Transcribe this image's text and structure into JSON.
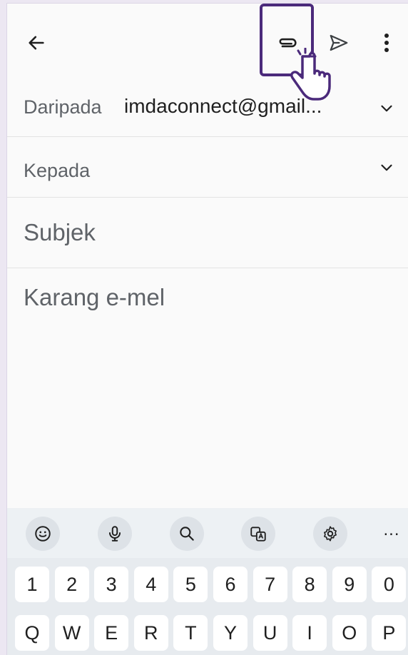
{
  "toolbar": {
    "back_icon": "arrow-left-icon",
    "attach_icon": "paperclip-icon",
    "send_icon": "send-icon",
    "more_icon": "more-vertical-icon"
  },
  "compose": {
    "from_label": "Daripada",
    "from_value": "imdaconnect@gmail...",
    "to_label": "Kepada",
    "subject_placeholder": "Subjek",
    "body_placeholder": "Karang e-mel"
  },
  "keyboard": {
    "tools": [
      "emoji-icon",
      "microphone-icon",
      "search-icon",
      "translate-icon",
      "settings-icon",
      "more-horizontal-icon"
    ],
    "more_label": "...",
    "number_row": [
      "1",
      "2",
      "3",
      "4",
      "5",
      "6",
      "7",
      "8",
      "9",
      "0"
    ],
    "letter_row": [
      "Q",
      "W",
      "E",
      "R",
      "T",
      "Y",
      "U",
      "I",
      "O",
      "P"
    ]
  },
  "colors": {
    "accent_highlight": "#4b2a7b",
    "text_primary": "#1f1f1f",
    "text_secondary": "#5f6368"
  }
}
